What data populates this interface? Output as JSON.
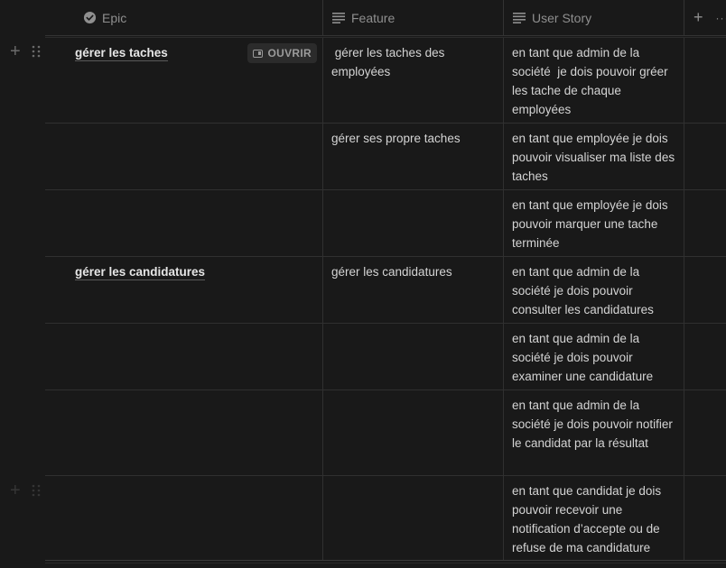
{
  "header": {
    "epic": "Epic",
    "feature": "Feature",
    "story": "User Story",
    "add": "+"
  },
  "open_label": "OUVRIR",
  "rows": [
    {
      "epic": "gérer les taches",
      "feature": " gérer les taches des employées",
      "story": "en tant que admin de la société  je dois pouvoir gréer les tache de chaque employées"
    },
    {
      "epic": "",
      "feature": "gérer ses propre taches",
      "story": "en tant que employée je dois pouvoir visualiser ma liste des taches"
    },
    {
      "epic": "",
      "feature": "",
      "story": "en tant que employée je dois pouvoir marquer une tache terminée"
    },
    {
      "epic": "gérer les candidatures",
      "feature": "gérer les candidatures",
      "story": "en tant que admin de la société je dois pouvoir consulter les candidatures"
    },
    {
      "epic": "",
      "feature": "",
      "story": "en tant que admin de la société je dois pouvoir examiner une candidature"
    },
    {
      "epic": "",
      "feature": "",
      "story": "en tant que admin de la société je dois pouvoir notifier le candidat par la résultat"
    },
    {
      "epic": "",
      "feature": "",
      "story": "en tant que candidat je dois pouvoir recevoir une notification d’accepte ou de refuse de ma candidature"
    }
  ],
  "icons": {
    "epic": "status-check-icon",
    "feature": "text-lines-icon",
    "story": "text-lines-icon",
    "gutter_add": "plus-icon",
    "gutter_drag": "drag-handle-icon"
  }
}
